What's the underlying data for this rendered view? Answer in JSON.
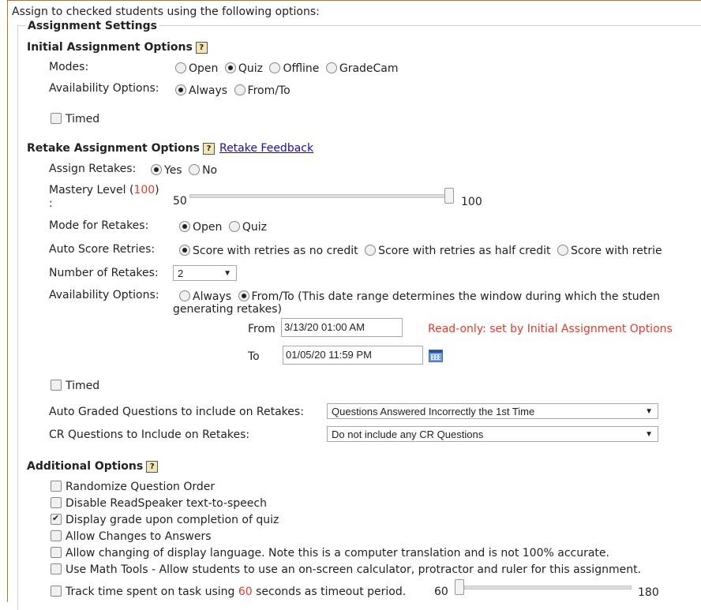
{
  "intro": "Assign to checked students using the following options:",
  "legend": "Assignment Settings",
  "help_glyph": "?",
  "initial": {
    "title": "Initial Assignment Options",
    "modes_label": "Modes:",
    "modes": [
      "Open",
      "Quiz",
      "Offline",
      "GradeCam"
    ],
    "modes_selected": "Quiz",
    "availability_label": "Availability Options:",
    "availability": [
      "Always",
      "From/To"
    ],
    "availability_selected": "Always",
    "timed_label": "Timed",
    "timed_checked": false
  },
  "retake": {
    "title": "Retake Assignment Options",
    "feedback_link": "Retake Feedback",
    "assign_label": "Assign Retakes:",
    "assign_yes": "Yes",
    "assign_no": "No",
    "mastery_label": "Mastery Level (",
    "mastery_value": "100",
    "mastery_close": ")",
    "mastery_colon": ":",
    "mastery_min": "50",
    "mastery_max": "100",
    "mode_label": "Mode for Retakes:",
    "mode_open": "Open",
    "mode_quiz": "Quiz",
    "auto_score_label": "Auto Score Retries:",
    "auto_score_1": "Score with retries as no credit",
    "auto_score_2": "Score with retries as half credit",
    "auto_score_3": "Score with retrie",
    "num_label": "Number of Retakes:",
    "num_value": "2",
    "avail_label": "Availability Options:",
    "avail_always": "Always",
    "avail_fromto": "From/To (This date range determines the window during which the studen",
    "avail_fromto_cont": "generating retakes)",
    "from_label": "From",
    "from_value": "3/13/20 01:00 AM",
    "readonly_note": "Read-only: set by Initial Assignment Options",
    "to_label": "To",
    "to_value": "01/05/20 11:59 PM",
    "timed_label": "Timed",
    "auto_graded_label": "Auto Graded Questions to include on Retakes:",
    "auto_graded_value": "Questions Answered Incorrectly the 1st Time",
    "cr_label": "CR Questions to Include on Retakes:",
    "cr_value": "Do not include any CR Questions"
  },
  "additional": {
    "title": "Additional Options",
    "items": [
      {
        "label": "Randomize Question Order",
        "checked": false
      },
      {
        "label": "Disable ReadSpeaker text-to-speech",
        "checked": false
      },
      {
        "label": "Display grade upon completion of quiz",
        "checked": true
      },
      {
        "label": "Allow Changes to Answers",
        "checked": false
      },
      {
        "label": "Allow changing of display language. Note this is a computer translation and is not 100% accurate.",
        "checked": false
      },
      {
        "label": "Use Math Tools - Allow students to use an on-screen calculator, protractor and ruler for this assignment.",
        "checked": false
      }
    ],
    "track_pre": "Track time spent on task using ",
    "track_value": "60",
    "track_post": " seconds as timeout period.",
    "track_min": "60",
    "track_max": "180"
  }
}
